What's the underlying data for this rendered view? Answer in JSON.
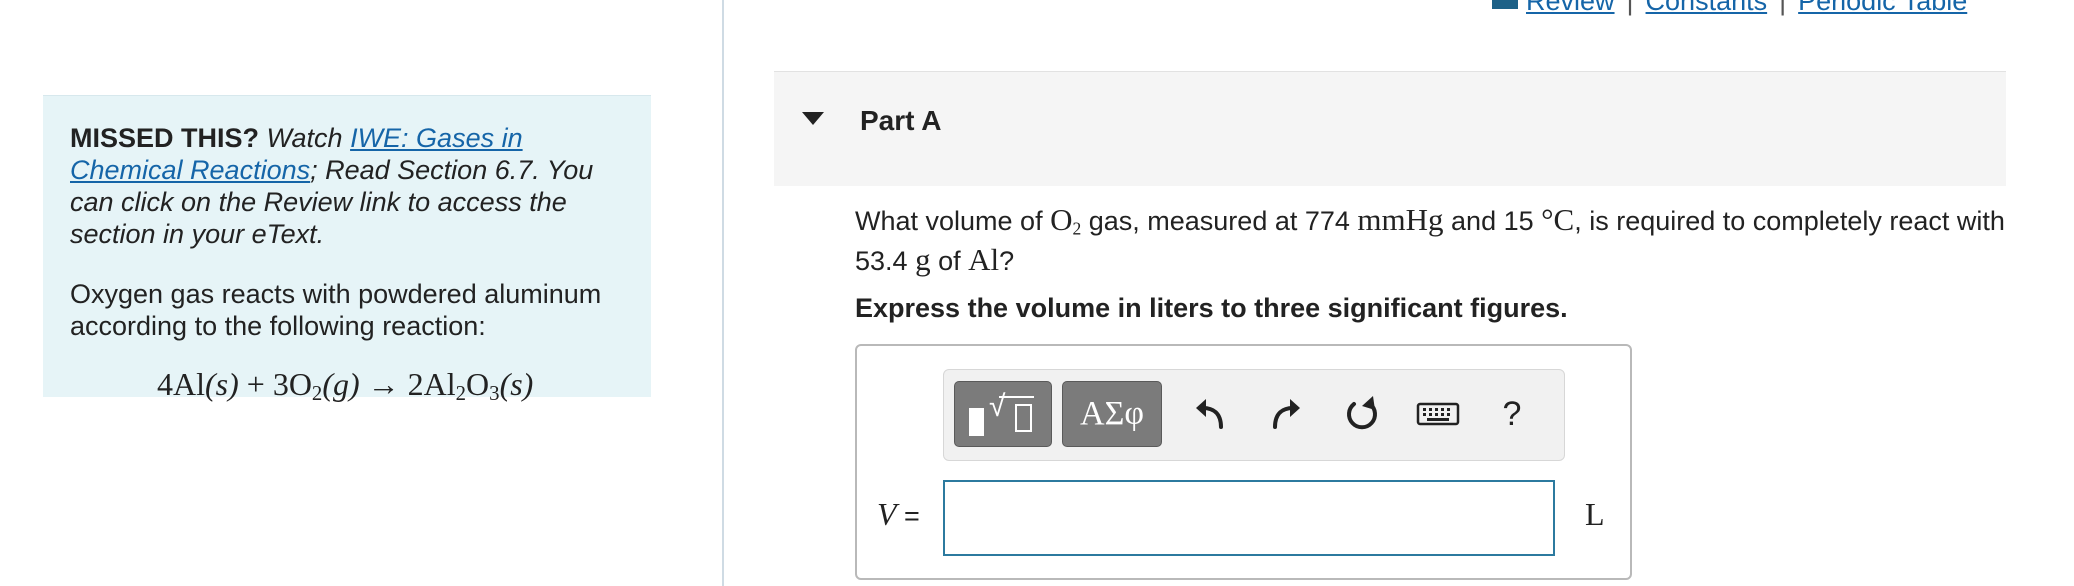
{
  "top_links": {
    "review": "Review",
    "constants": "Constants",
    "periodic_table": "Periodic Table",
    "separator": "|"
  },
  "hint": {
    "missed": "MISSED THIS?",
    "watch": " Watch ",
    "video_link": "IWE: Gases in Chemical Reactions",
    "after_link": "; Read Section 6.7. You can click on the Review link to access the section in your eText.",
    "body": "Oxygen gas reacts with powdered aluminum according to the following reaction:",
    "reaction": {
      "r1_coef": "4Al",
      "state_s": "(s)",
      "plus": "+",
      "r2_coef": "3O",
      "o_sub": "2",
      "state_g": "(g)",
      "arrow": "→",
      "product": "2Al",
      "al_sub": "2",
      "product_o": "O",
      "o3_sub": "3"
    }
  },
  "part": {
    "title": "Part A"
  },
  "question": {
    "t1": "What volume of ",
    "o2": "O",
    "o2_sub": "2",
    "t2": " gas, measured at 774 ",
    "mmhg": "mmHg",
    "t3": " and 15 ",
    "degc": "°C",
    "t4": ", is required to completely react with",
    "t5": "53.4 ",
    "g": "g",
    "t6": " of ",
    "al": "Al",
    "t7": "?"
  },
  "instruction": "Express the volume in liters to three significant figures.",
  "toolbar": {
    "templates_label": "√",
    "greek_label": "ΑΣφ",
    "help_label": "?"
  },
  "answer": {
    "variable": "V",
    "equals": " =",
    "value": "",
    "unit": "L"
  },
  "colors": {
    "link": "#1565a8",
    "hint_bg": "#e6f4f7",
    "input_border": "#2c7a9f",
    "toolbar_button": "#7b7b7b"
  }
}
